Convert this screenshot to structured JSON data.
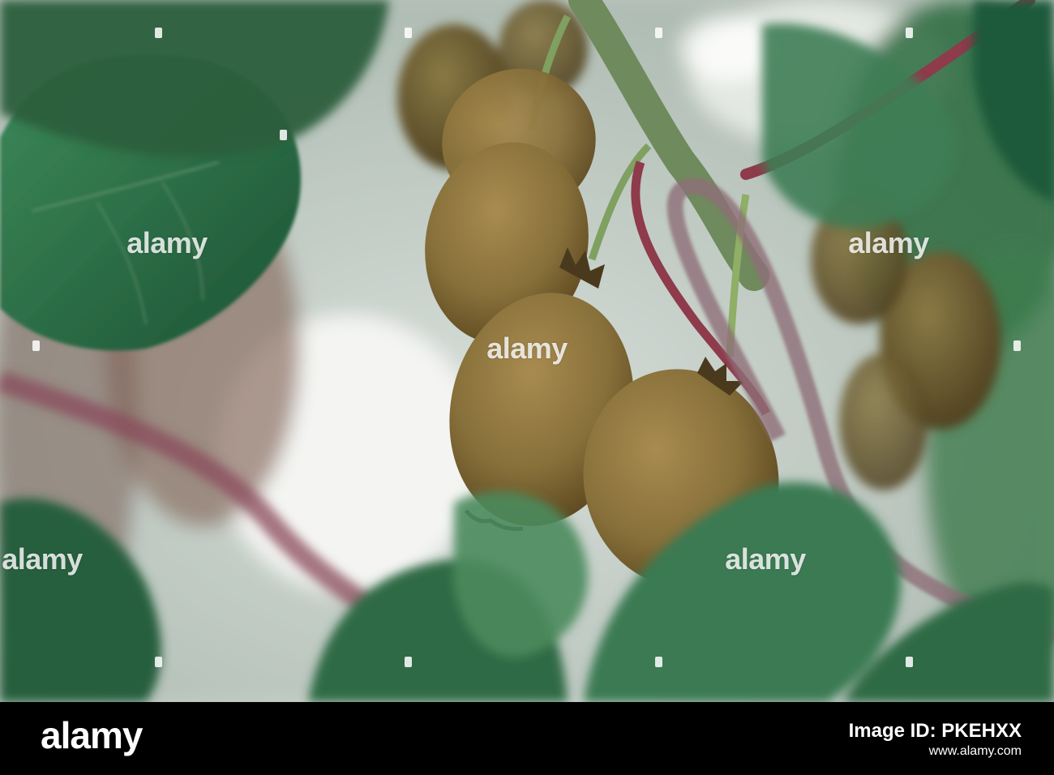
{
  "photo": {
    "subject": "kiwi-fruit-on-vine",
    "palette": {
      "sky": "#e8ecea",
      "leaf_dark": "#1f5a3a",
      "leaf_mid": "#3f7d4f",
      "kiwi_skin": "#8a6e3a",
      "kiwi_shadow": "#5d4820",
      "stem_red": "#8e3b4b",
      "stem_green": "#7fa060"
    }
  },
  "watermark": {
    "text": "alamy"
  },
  "footer": {
    "logo": "alamy",
    "image_id_label": "Image ID: PKEHXX",
    "site": "www.alamy.com",
    "background": "#000000",
    "text_color": "#ffffff"
  }
}
